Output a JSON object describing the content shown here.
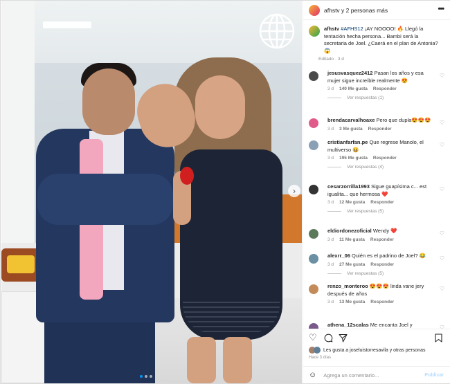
{
  "header": {
    "title": "afhstv y 2 personas más",
    "more_icon": "more-horizontal-icon"
  },
  "caption": {
    "username": "afhstv",
    "hashtag": "#AFHS12",
    "text": " ¡AY NOOOO! 🔥 Llegó la tentación hecha persona... Bambi será la secretaria de Joel. ¿Caerá en el plan de Antonia? 😱",
    "meta": "Editado · 3 d"
  },
  "comments": [
    {
      "user": "jesusvasquez2412",
      "text": "Pasan los años y esa mujer sigue increíble realmente 😍",
      "time": "3 d",
      "likes": "140 Me gusta",
      "reply": "Responder",
      "replies": "Ver respuestas (1)",
      "avatar": "#4a4a4a"
    },
    {
      "user": "brendacarvalhoaxe",
      "text": "Pero que dupla😍😍😍",
      "time": "3 d",
      "likes": "3 Me gusta",
      "reply": "Responder",
      "replies": "",
      "avatar": "#e05a8a"
    },
    {
      "user": "cristianfarfan.pe",
      "text": "Que regrese Manolo, el multiverso 😆",
      "time": "3 d",
      "likes": "195 Me gusta",
      "reply": "Responder",
      "replies": "Ver respuestas (4)",
      "avatar": "#8aa0b4"
    },
    {
      "user": "cesarzorrilla1993",
      "text": "Sigue guapísima c... est igualita... que hermosa ❤️",
      "time": "3 d",
      "likes": "12 Me gusta",
      "reply": "Responder",
      "replies": "Ver respuestas (5)",
      "avatar": "#333333"
    },
    {
      "user": "eldiordonezoficial",
      "text": "Wendy ❤️",
      "time": "3 d",
      "likes": "11 Me gusta",
      "reply": "Responder",
      "replies": "",
      "avatar": "#5b7a5a"
    },
    {
      "user": "alexrr_06",
      "text": "Quién es el padrino de Joel? 😂",
      "time": "3 d",
      "likes": "27 Me gusta",
      "reply": "Responder",
      "replies": "Ver respuestas (5)",
      "avatar": "#6b8fa3"
    },
    {
      "user": "renzo_monteroo",
      "text": "😍😍😍 linda vane jery después de años",
      "time": "3 d",
      "likes": "13 Me gusta",
      "reply": "Responder",
      "replies": "",
      "avatar": "#c48b5a"
    },
    {
      "user": "athena_12scalas",
      "text": "Me encanta Joel y Macarena",
      "time": "",
      "likes": "",
      "reply": "",
      "replies": "",
      "avatar": "#7a5a8a"
    }
  ],
  "actions": {
    "like_icon": "heart-outline-icon",
    "comment_icon": "comment-icon",
    "share_icon": "paper-plane-icon",
    "save_icon": "bookmark-icon",
    "likes_text": "Les gusta a joseluistorresavila y otras personas",
    "date": "Hace 3 días"
  },
  "composer": {
    "placeholder": "Agrega un comentario...",
    "publish": "Publicar",
    "emoji_icon": "smiley-icon"
  },
  "photo": {
    "alt": "Two people posing in an office",
    "brand_icon": "globe-logo-icon"
  },
  "colors": {
    "link": "#00376b",
    "muted": "#8e8e8e",
    "publish": "#b3dbff",
    "accent": "#0095f6"
  }
}
